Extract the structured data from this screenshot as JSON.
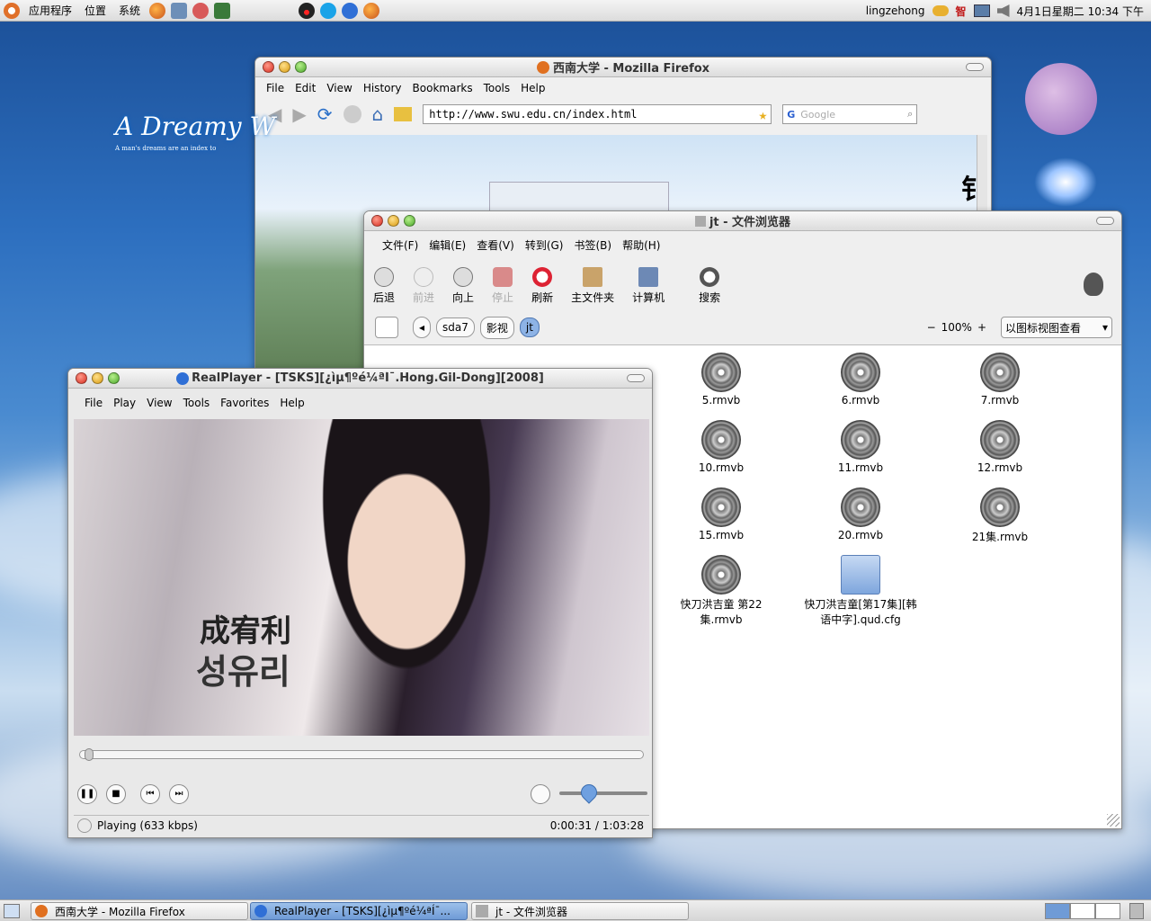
{
  "top_panel": {
    "menus": [
      "应用程序",
      "位置",
      "系统"
    ],
    "launchers": [
      "firefox-icon",
      "network-icon",
      "mail-icon",
      "monitor-icon"
    ],
    "center_icons": [
      "qq-icon",
      "skype-icon",
      "realplayer-icon",
      "firefox-icon"
    ],
    "user": "lingzehong",
    "ime_label": "智",
    "datetime": "4月1日星期二 10:34 下午"
  },
  "firefox": {
    "title": "西南大学 - Mozilla Firefox",
    "menus": [
      "File",
      "Edit",
      "View",
      "History",
      "Bookmarks",
      "Tools",
      "Help"
    ],
    "url": "http://www.swu.edu.cn/index.html",
    "search_placeholder": "Google",
    "page_banner_text": "A Dreamy W",
    "page_banner_sub": "A man's dreams are an index to",
    "page_side_char": "钅"
  },
  "nautilus": {
    "title": "jt - 文件浏览器",
    "menus": [
      "文件(F)",
      "编辑(E)",
      "查看(V)",
      "转到(G)",
      "书签(B)",
      "帮助(H)"
    ],
    "toolbar": [
      {
        "label": "后退",
        "icon": "back-icon",
        "enabled": true
      },
      {
        "label": "前进",
        "icon": "forward-icon",
        "enabled": false
      },
      {
        "label": "向上",
        "icon": "up-icon",
        "enabled": true
      },
      {
        "label": "停止",
        "icon": "stop-icon",
        "enabled": false
      },
      {
        "label": "刷新",
        "icon": "refresh-icon",
        "enabled": true
      },
      {
        "label": "主文件夹",
        "icon": "home-icon",
        "enabled": true
      },
      {
        "label": "计算机",
        "icon": "computer-icon",
        "enabled": true
      },
      {
        "label": "搜索",
        "icon": "search-icon",
        "enabled": true
      }
    ],
    "path": [
      "sda7",
      "影视",
      "jt"
    ],
    "zoom": "100%",
    "view_mode": "以图标视图查看",
    "files": [
      {
        "name": "5.rmvb",
        "type": "video"
      },
      {
        "name": "6.rmvb",
        "type": "video"
      },
      {
        "name": "7.rmvb",
        "type": "video"
      },
      {
        "name": "10.rmvb",
        "type": "video"
      },
      {
        "name": "11.rmvb",
        "type": "video"
      },
      {
        "name": "12.rmvb",
        "type": "video"
      },
      {
        "name": "15.rmvb",
        "type": "video"
      },
      {
        "name": "20.rmvb",
        "type": "video"
      },
      {
        "name": "21集.rmvb",
        "type": "video"
      },
      {
        "name": "快刀洪吉童 第22集.rmvb",
        "type": "video"
      },
      {
        "name": "快刀洪吉童[第17集][韩语中字].qud.cfg",
        "type": "folder"
      }
    ]
  },
  "realplayer": {
    "title": "RealPlayer - [TSKS][¿ìµ¶ºé¼ªÍ¯.Hong.Gil-Dong][2008]",
    "menus": [
      "File",
      "Play",
      "View",
      "Tools",
      "Favorites",
      "Help"
    ],
    "video_caption_cn": "成宥利",
    "video_caption_kr": "성유리",
    "status": "Playing (633 kbps)",
    "time": "0:00:31 / 1:03:28",
    "progress": 0.008,
    "volume": 0.33
  },
  "taskbar": [
    {
      "label": "西南大学 - Mozilla Firefox",
      "active": false
    },
    {
      "label": "RealPlayer - [TSKS][¿ìµ¶ºé¼ªÍ¯...",
      "active": true
    },
    {
      "label": "jt - 文件浏览器",
      "active": false
    }
  ],
  "colors": {
    "accent": "#6f9bd6",
    "desktop": "#2d6fbf"
  }
}
